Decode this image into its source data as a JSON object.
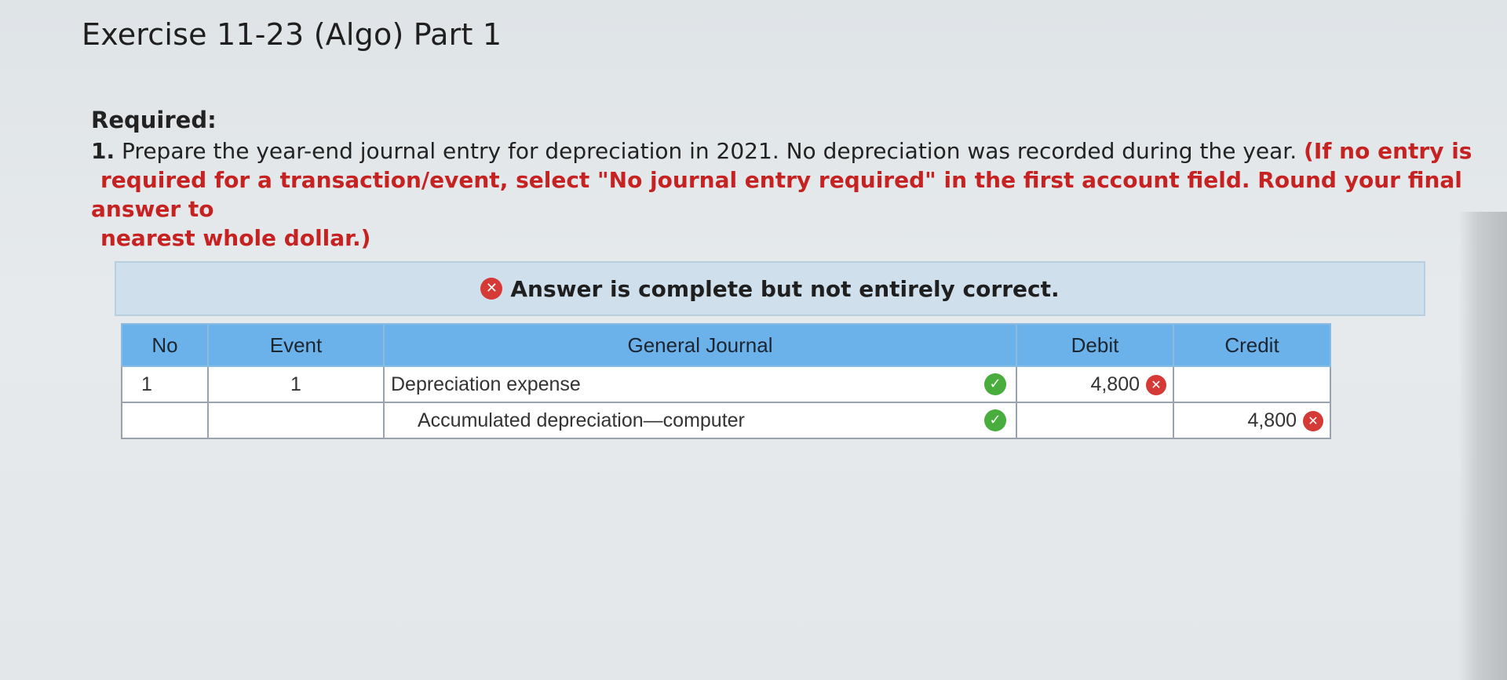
{
  "page": {
    "title": "Exercise 11-23 (Algo) Part 1"
  },
  "required": {
    "heading": "Required:",
    "item_number": "1.",
    "text": " Prepare the year-end journal entry for depreciation in 2021. No depreciation was recorded during the year. ",
    "note_line1": "(If no entry is",
    "note_line2": "required for a transaction/event, select \"No journal entry required\" in the first account field. Round your final answer to",
    "note_line3": "nearest whole dollar.)"
  },
  "banner": {
    "icon": "x-circle-icon",
    "message": "Answer is complete but not entirely correct.",
    "color": "#cfe0ec"
  },
  "table": {
    "columns": [
      "No",
      "Event",
      "General Journal",
      "Debit",
      "Credit"
    ],
    "rows": [
      {
        "no": "1",
        "event": "1",
        "account": "Depreciation expense",
        "account_status": "correct",
        "debit": "4,800",
        "debit_status": "incorrect",
        "credit": "",
        "credit_status": ""
      },
      {
        "no": "",
        "event": "",
        "account": "Accumulated depreciation—computer",
        "account_status": "correct",
        "debit": "",
        "debit_status": "",
        "credit": "4,800",
        "credit_status": "incorrect"
      }
    ],
    "header_color": "#6cb2ea",
    "correct_color": "#49ad3e",
    "incorrect_color": "#d63a36"
  }
}
